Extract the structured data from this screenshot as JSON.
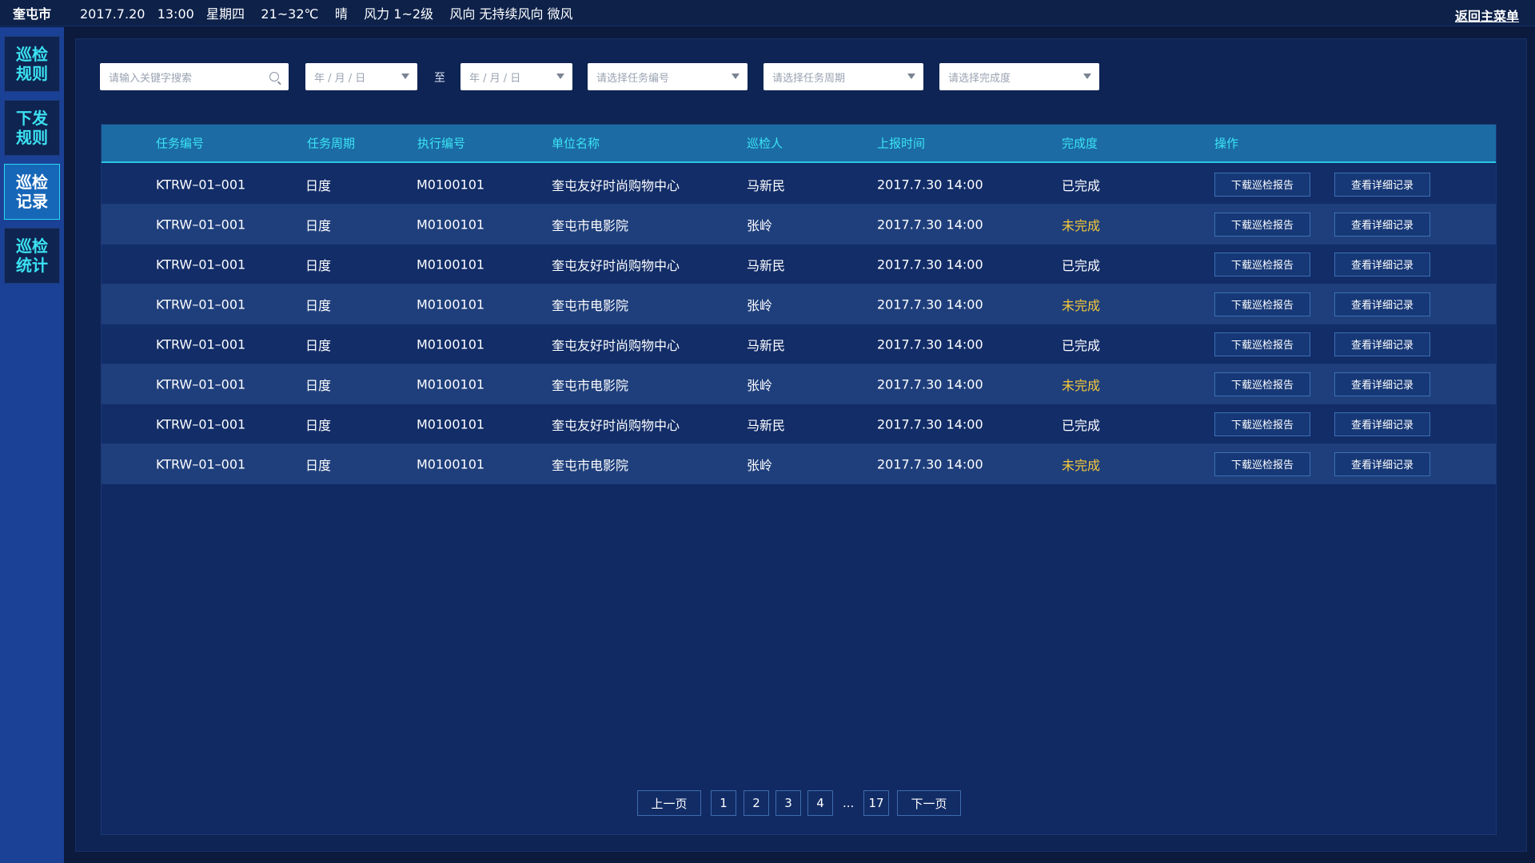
{
  "topbar": {
    "city": "奎屯市",
    "info": "2017.7.20   13:00   星期四    21~32℃    晴    风力 1~2级    风向 无持续风向 微风",
    "back_label": "返回主菜单"
  },
  "sidebar": {
    "items": [
      {
        "label": "巡检规则",
        "active": false
      },
      {
        "label": "下发规则",
        "active": false
      },
      {
        "label": "巡检记录",
        "active": true
      },
      {
        "label": "巡检统计",
        "active": false
      }
    ]
  },
  "filters": {
    "keyword_placeholder": "请输入关键字搜索",
    "date_from_placeholder": "年 / 月 / 日",
    "to_label": "至",
    "date_to_placeholder": "年 / 月 / 日",
    "task_no_placeholder": "请选择任务编号",
    "cycle_placeholder": "请选择任务周期",
    "completion_placeholder": "请选择完成度"
  },
  "table": {
    "columns": [
      "任务编号",
      "任务周期",
      "执行编号",
      "单位名称",
      "巡检人",
      "上报时间",
      "完成度",
      "操作"
    ],
    "rows": [
      {
        "task_no": "KTRW–01–001",
        "cycle": "日度",
        "exec_no": "M0100101",
        "unit": "奎屯友好时尚购物中心",
        "inspector": "马新民",
        "time": "2017.7.30  14:00",
        "status": "已完成",
        "done": true
      },
      {
        "task_no": "KTRW–01–001",
        "cycle": "日度",
        "exec_no": "M0100101",
        "unit": "奎屯市电影院",
        "inspector": "张岭",
        "time": "2017.7.30  14:00",
        "status": "未完成",
        "done": false
      },
      {
        "task_no": "KTRW–01–001",
        "cycle": "日度",
        "exec_no": "M0100101",
        "unit": "奎屯友好时尚购物中心",
        "inspector": "马新民",
        "time": "2017.7.30  14:00",
        "status": "已完成",
        "done": true
      },
      {
        "task_no": "KTRW–01–001",
        "cycle": "日度",
        "exec_no": "M0100101",
        "unit": "奎屯市电影院",
        "inspector": "张岭",
        "time": "2017.7.30  14:00",
        "status": "未完成",
        "done": false
      },
      {
        "task_no": "KTRW–01–001",
        "cycle": "日度",
        "exec_no": "M0100101",
        "unit": "奎屯友好时尚购物中心",
        "inspector": "马新民",
        "time": "2017.7.30  14:00",
        "status": "已完成",
        "done": true
      },
      {
        "task_no": "KTRW–01–001",
        "cycle": "日度",
        "exec_no": "M0100101",
        "unit": "奎屯市电影院",
        "inspector": "张岭",
        "time": "2017.7.30  14:00",
        "status": "未完成",
        "done": false
      },
      {
        "task_no": "KTRW–01–001",
        "cycle": "日度",
        "exec_no": "M0100101",
        "unit": "奎屯友好时尚购物中心",
        "inspector": "马新民",
        "time": "2017.7.30  14:00",
        "status": "已完成",
        "done": true
      },
      {
        "task_no": "KTRW–01–001",
        "cycle": "日度",
        "exec_no": "M0100101",
        "unit": "奎屯市电影院",
        "inspector": "张岭",
        "time": "2017.7.30  14:00",
        "status": "未完成",
        "done": false
      }
    ],
    "download_label": "下载巡检报告",
    "detail_label": "查看详细记录"
  },
  "pagination": {
    "prev": "上一页",
    "pages": [
      "1",
      "2",
      "3",
      "4"
    ],
    "ellipsis": "...",
    "last": "17",
    "next": "下一页"
  },
  "colors": {
    "accent": "#3be1f2",
    "pending": "#f6c93a",
    "header_bg": "#1c6ba4",
    "sidebar_bg": "#1b4196"
  }
}
